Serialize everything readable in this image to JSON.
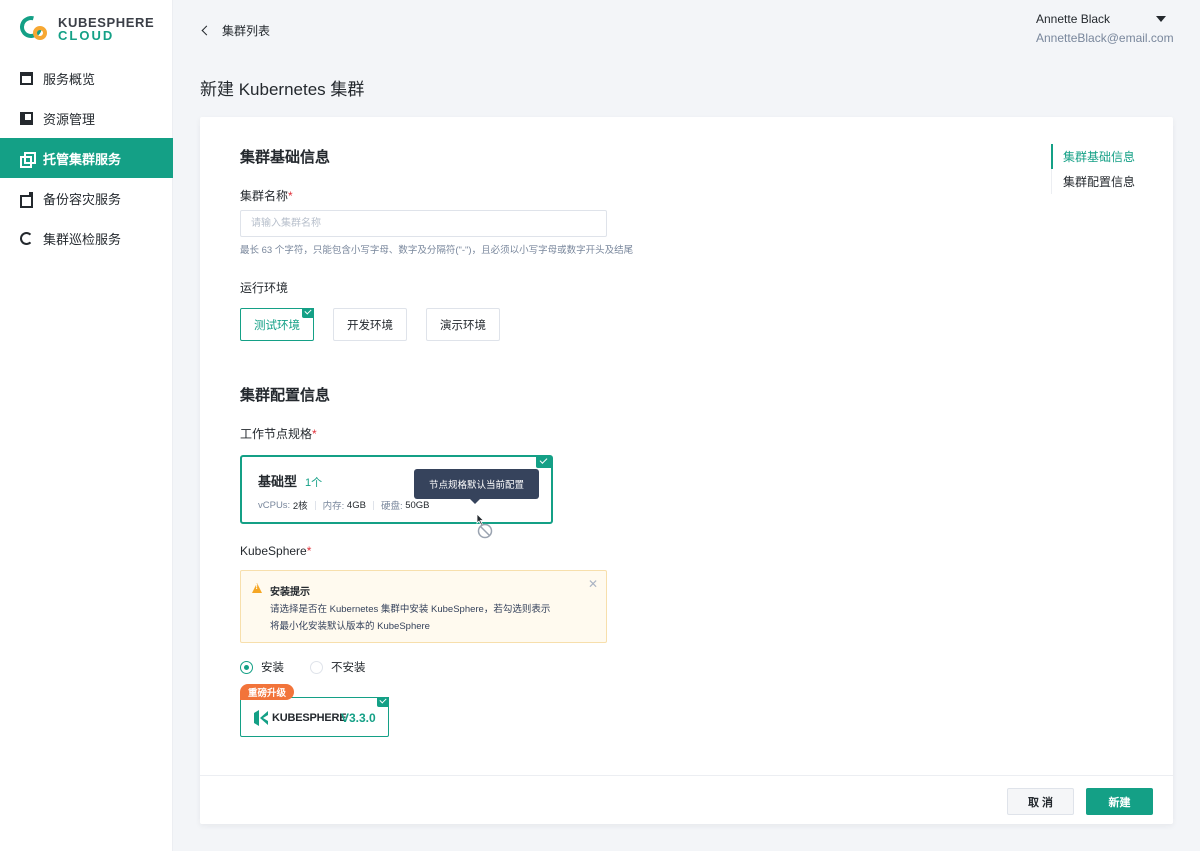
{
  "brand": {
    "line1": "KUBESPHERE",
    "line2": "CLOUD",
    "primary_color": "#14a086",
    "accent_color": "#f7a833"
  },
  "sidebar": {
    "items": [
      {
        "label": "服务概览",
        "icon": "overview-icon",
        "active": false
      },
      {
        "label": "资源管理",
        "icon": "resource-icon",
        "active": false
      },
      {
        "label": "托管集群服务",
        "icon": "managed-cluster-icon",
        "active": true
      },
      {
        "label": "备份容灾服务",
        "icon": "backup-icon",
        "active": false
      },
      {
        "label": "集群巡检服务",
        "icon": "inspection-icon",
        "active": false
      }
    ]
  },
  "header": {
    "back_label": "集群列表",
    "user_name": "Annette Black",
    "user_email": "AnnetteBlack@email.com",
    "page_title": "新建 Kubernetes 集群"
  },
  "form": {
    "basic_section_title": "集群基础信息",
    "cluster_name_label": "集群名称",
    "required_mark": "*",
    "cluster_name_value": "",
    "cluster_name_placeholder": "请输入集群名称",
    "cluster_name_hint": "最长 63 个字符，只能包含小写字母、数字及分隔符(\"-\")，且必须以小写字母或数字开头及结尾",
    "env_label": "运行环境",
    "env_options": [
      {
        "label": "测试环境",
        "selected": true
      },
      {
        "label": "开发环境",
        "selected": false
      },
      {
        "label": "演示环境",
        "selected": false
      }
    ],
    "config_section_title": "集群配置信息",
    "node_spec_label": "工作节点规格",
    "node_spec": {
      "name": "基础型",
      "count": "1个",
      "vcpu_label": "vCPUs:",
      "vcpu_value": "2核",
      "memory_label": "内存:",
      "memory_value": "4GB",
      "disk_label": "硬盘:",
      "disk_value": "50GB"
    },
    "tooltip": "节点规格默认当前配置",
    "kubesphere_label": "KubeSphere",
    "alert": {
      "title": "安装提示",
      "body_line1": "请选择是否在 Kubernetes 集群中安装 KubeSphere，若勾选则表示",
      "body_line2": "将最小化安装默认版本的 KubeSphere"
    },
    "install_options": [
      {
        "label": "安装",
        "selected": true
      },
      {
        "label": "不安装",
        "selected": false
      }
    ],
    "version_badge": "重磅升级",
    "version_product": "KUBESPHERE",
    "version_number": "V3.3.0"
  },
  "anchors": [
    {
      "label": "集群基础信息",
      "active": true
    },
    {
      "label": "集群配置信息",
      "active": false
    }
  ],
  "footer": {
    "cancel_label": "取 消",
    "create_label": "新建"
  }
}
